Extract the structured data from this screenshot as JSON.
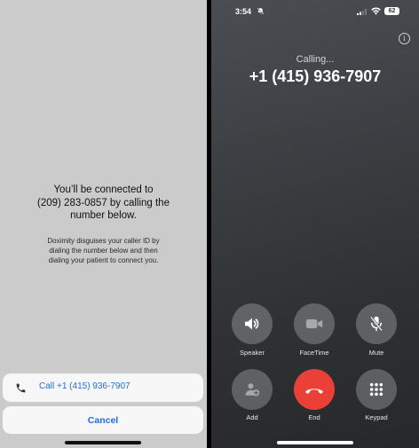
{
  "left": {
    "title_lines": [
      "You’ll be connected to",
      "(209) 283-0857 by calling the",
      "number below."
    ],
    "subtitle_lines": [
      "Doximity disguises your caller ID by",
      "dialing the number below and then",
      "dialing your patient to connect you."
    ],
    "call_button_label": "Call +1 (415) 936-7907",
    "cancel_button_label": "Cancel",
    "accent_color": "#1d6fe0"
  },
  "right": {
    "status": {
      "time": "3:54",
      "battery": "62"
    },
    "call_status": "Calling...",
    "number": "+1 (415) 936-7907",
    "buttons": {
      "speaker": "Speaker",
      "facetime": "FaceTime",
      "mute": "Mute",
      "add": "Add",
      "end": "End",
      "keypad": "Keypad"
    },
    "end_color": "#eb4037"
  }
}
